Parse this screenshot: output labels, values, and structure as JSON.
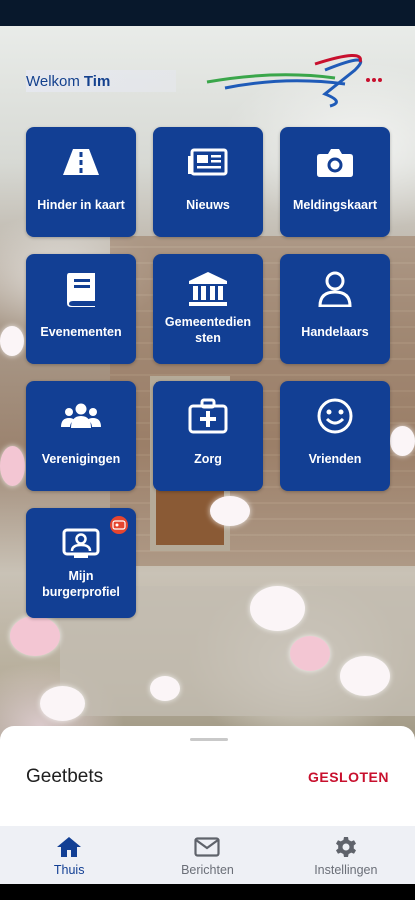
{
  "header": {
    "welcome_prefix": "Welkom",
    "welcome_name": "Tim"
  },
  "tiles": [
    {
      "label": "Hinder in kaart",
      "icon": "road-icon"
    },
    {
      "label": "Nieuws",
      "icon": "newspaper-icon"
    },
    {
      "label": "Meldingskaart",
      "icon": "camera-icon"
    },
    {
      "label": "Evenementen",
      "icon": "book-icon"
    },
    {
      "label": "Gemeentedien\nsten",
      "icon": "town-hall-icon"
    },
    {
      "label": "Handelaars",
      "icon": "person-icon"
    },
    {
      "label": "Verenigingen",
      "icon": "group-icon"
    },
    {
      "label": "Zorg",
      "icon": "first-aid-icon"
    },
    {
      "label": "Vrienden",
      "icon": "smiley-icon"
    },
    {
      "label": "Mijn\nburgerprofiel",
      "icon": "profile-card-icon",
      "badge": "bp"
    }
  ],
  "sheet": {
    "title": "Geetbets",
    "status": "GESLOTEN"
  },
  "nav": [
    {
      "label": "Thuis",
      "icon": "home-icon",
      "active": true
    },
    {
      "label": "Berichten",
      "icon": "envelope-icon",
      "active": false
    },
    {
      "label": "Instellingen",
      "icon": "gear-icon",
      "active": false
    }
  ],
  "colors": {
    "tile": "#123f94",
    "status_closed": "#c8102e",
    "nav_active": "#123f94"
  }
}
